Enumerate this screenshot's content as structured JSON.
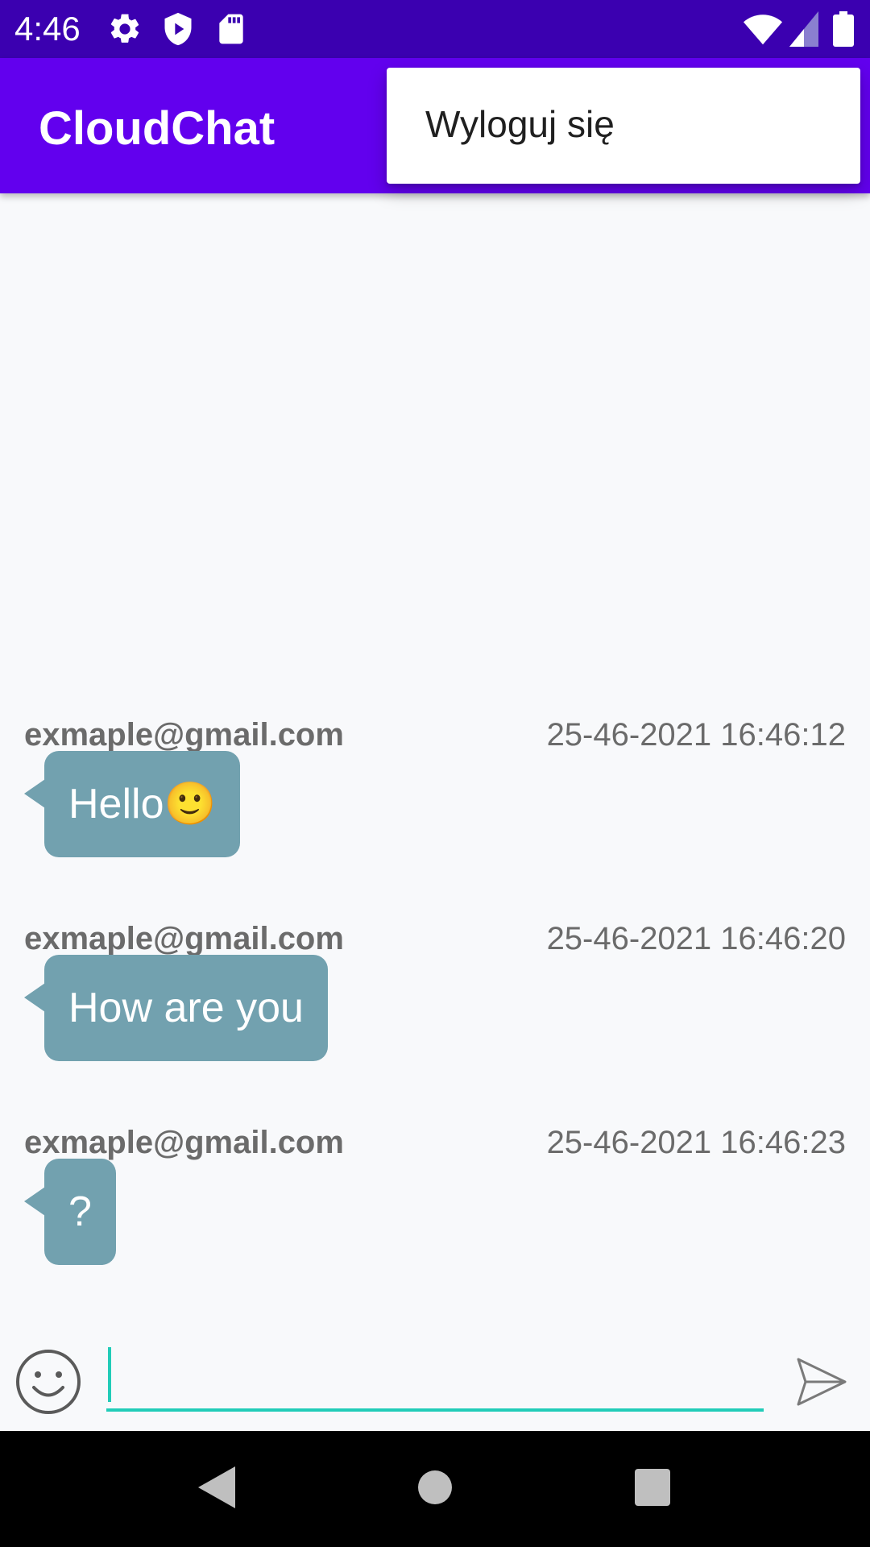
{
  "status_bar": {
    "time": "4:46",
    "icons": [
      "gear-icon",
      "shield-play-icon",
      "sd-card-icon",
      "wifi-icon",
      "signal-icon",
      "battery-icon"
    ]
  },
  "app_bar": {
    "title": "CloudChat"
  },
  "overflow_menu": {
    "items": [
      {
        "label": "Wyloguj się"
      }
    ]
  },
  "messages": [
    {
      "sender": "exmaple@gmail.com",
      "timestamp": "25-46-2021 16:46:12",
      "text": "Hello🙂"
    },
    {
      "sender": "exmaple@gmail.com",
      "timestamp": "25-46-2021 16:46:20",
      "text": "How are you"
    },
    {
      "sender": "exmaple@gmail.com",
      "timestamp": "25-46-2021 16:46:23",
      "text": "?"
    }
  ],
  "composer": {
    "value": "",
    "placeholder": "",
    "emoji_icon": "smiley-icon",
    "send_icon": "send-icon"
  },
  "nav_bar": {
    "icons": [
      "back-icon",
      "home-icon",
      "recents-icon"
    ]
  },
  "colors": {
    "status_bar": "#3b00b0",
    "app_bar": "#6200ee",
    "bubble": "#72a1af",
    "input_underline": "#22ccb8",
    "background": "#f8f9fb"
  }
}
